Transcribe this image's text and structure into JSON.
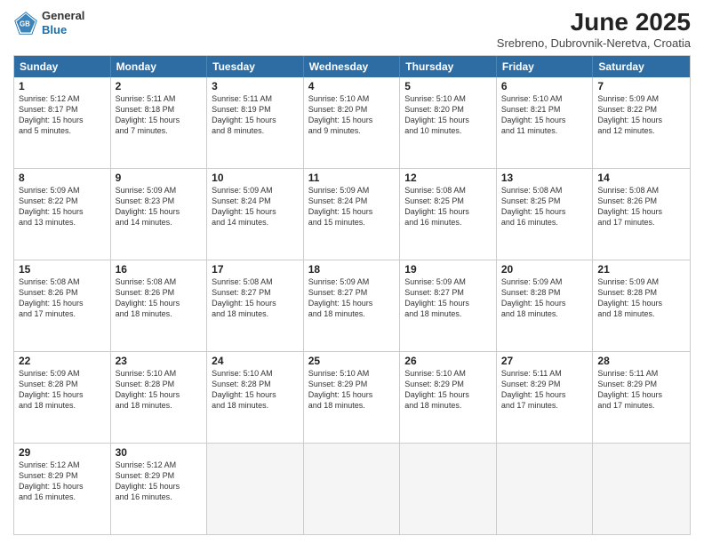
{
  "logo": {
    "general": "General",
    "blue": "Blue"
  },
  "title": "June 2025",
  "subtitle": "Srebreno, Dubrovnik-Neretva, Croatia",
  "header_days": [
    "Sunday",
    "Monday",
    "Tuesday",
    "Wednesday",
    "Thursday",
    "Friday",
    "Saturday"
  ],
  "rows": [
    [
      {
        "day": "1",
        "lines": [
          "Sunrise: 5:12 AM",
          "Sunset: 8:17 PM",
          "Daylight: 15 hours",
          "and 5 minutes."
        ]
      },
      {
        "day": "2",
        "lines": [
          "Sunrise: 5:11 AM",
          "Sunset: 8:18 PM",
          "Daylight: 15 hours",
          "and 7 minutes."
        ]
      },
      {
        "day": "3",
        "lines": [
          "Sunrise: 5:11 AM",
          "Sunset: 8:19 PM",
          "Daylight: 15 hours",
          "and 8 minutes."
        ]
      },
      {
        "day": "4",
        "lines": [
          "Sunrise: 5:10 AM",
          "Sunset: 8:20 PM",
          "Daylight: 15 hours",
          "and 9 minutes."
        ]
      },
      {
        "day": "5",
        "lines": [
          "Sunrise: 5:10 AM",
          "Sunset: 8:20 PM",
          "Daylight: 15 hours",
          "and 10 minutes."
        ]
      },
      {
        "day": "6",
        "lines": [
          "Sunrise: 5:10 AM",
          "Sunset: 8:21 PM",
          "Daylight: 15 hours",
          "and 11 minutes."
        ]
      },
      {
        "day": "7",
        "lines": [
          "Sunrise: 5:09 AM",
          "Sunset: 8:22 PM",
          "Daylight: 15 hours",
          "and 12 minutes."
        ]
      }
    ],
    [
      {
        "day": "8",
        "lines": [
          "Sunrise: 5:09 AM",
          "Sunset: 8:22 PM",
          "Daylight: 15 hours",
          "and 13 minutes."
        ]
      },
      {
        "day": "9",
        "lines": [
          "Sunrise: 5:09 AM",
          "Sunset: 8:23 PM",
          "Daylight: 15 hours",
          "and 14 minutes."
        ]
      },
      {
        "day": "10",
        "lines": [
          "Sunrise: 5:09 AM",
          "Sunset: 8:24 PM",
          "Daylight: 15 hours",
          "and 14 minutes."
        ]
      },
      {
        "day": "11",
        "lines": [
          "Sunrise: 5:09 AM",
          "Sunset: 8:24 PM",
          "Daylight: 15 hours",
          "and 15 minutes."
        ]
      },
      {
        "day": "12",
        "lines": [
          "Sunrise: 5:08 AM",
          "Sunset: 8:25 PM",
          "Daylight: 15 hours",
          "and 16 minutes."
        ]
      },
      {
        "day": "13",
        "lines": [
          "Sunrise: 5:08 AM",
          "Sunset: 8:25 PM",
          "Daylight: 15 hours",
          "and 16 minutes."
        ]
      },
      {
        "day": "14",
        "lines": [
          "Sunrise: 5:08 AM",
          "Sunset: 8:26 PM",
          "Daylight: 15 hours",
          "and 17 minutes."
        ]
      }
    ],
    [
      {
        "day": "15",
        "lines": [
          "Sunrise: 5:08 AM",
          "Sunset: 8:26 PM",
          "Daylight: 15 hours",
          "and 17 minutes."
        ]
      },
      {
        "day": "16",
        "lines": [
          "Sunrise: 5:08 AM",
          "Sunset: 8:26 PM",
          "Daylight: 15 hours",
          "and 18 minutes."
        ]
      },
      {
        "day": "17",
        "lines": [
          "Sunrise: 5:08 AM",
          "Sunset: 8:27 PM",
          "Daylight: 15 hours",
          "and 18 minutes."
        ]
      },
      {
        "day": "18",
        "lines": [
          "Sunrise: 5:09 AM",
          "Sunset: 8:27 PM",
          "Daylight: 15 hours",
          "and 18 minutes."
        ]
      },
      {
        "day": "19",
        "lines": [
          "Sunrise: 5:09 AM",
          "Sunset: 8:27 PM",
          "Daylight: 15 hours",
          "and 18 minutes."
        ]
      },
      {
        "day": "20",
        "lines": [
          "Sunrise: 5:09 AM",
          "Sunset: 8:28 PM",
          "Daylight: 15 hours",
          "and 18 minutes."
        ]
      },
      {
        "day": "21",
        "lines": [
          "Sunrise: 5:09 AM",
          "Sunset: 8:28 PM",
          "Daylight: 15 hours",
          "and 18 minutes."
        ]
      }
    ],
    [
      {
        "day": "22",
        "lines": [
          "Sunrise: 5:09 AM",
          "Sunset: 8:28 PM",
          "Daylight: 15 hours",
          "and 18 minutes."
        ]
      },
      {
        "day": "23",
        "lines": [
          "Sunrise: 5:10 AM",
          "Sunset: 8:28 PM",
          "Daylight: 15 hours",
          "and 18 minutes."
        ]
      },
      {
        "day": "24",
        "lines": [
          "Sunrise: 5:10 AM",
          "Sunset: 8:28 PM",
          "Daylight: 15 hours",
          "and 18 minutes."
        ]
      },
      {
        "day": "25",
        "lines": [
          "Sunrise: 5:10 AM",
          "Sunset: 8:29 PM",
          "Daylight: 15 hours",
          "and 18 minutes."
        ]
      },
      {
        "day": "26",
        "lines": [
          "Sunrise: 5:10 AM",
          "Sunset: 8:29 PM",
          "Daylight: 15 hours",
          "and 18 minutes."
        ]
      },
      {
        "day": "27",
        "lines": [
          "Sunrise: 5:11 AM",
          "Sunset: 8:29 PM",
          "Daylight: 15 hours",
          "and 17 minutes."
        ]
      },
      {
        "day": "28",
        "lines": [
          "Sunrise: 5:11 AM",
          "Sunset: 8:29 PM",
          "Daylight: 15 hours",
          "and 17 minutes."
        ]
      }
    ],
    [
      {
        "day": "29",
        "lines": [
          "Sunrise: 5:12 AM",
          "Sunset: 8:29 PM",
          "Daylight: 15 hours",
          "and 16 minutes."
        ]
      },
      {
        "day": "30",
        "lines": [
          "Sunrise: 5:12 AM",
          "Sunset: 8:29 PM",
          "Daylight: 15 hours",
          "and 16 minutes."
        ]
      },
      {
        "day": "",
        "lines": []
      },
      {
        "day": "",
        "lines": []
      },
      {
        "day": "",
        "lines": []
      },
      {
        "day": "",
        "lines": []
      },
      {
        "day": "",
        "lines": []
      }
    ]
  ]
}
